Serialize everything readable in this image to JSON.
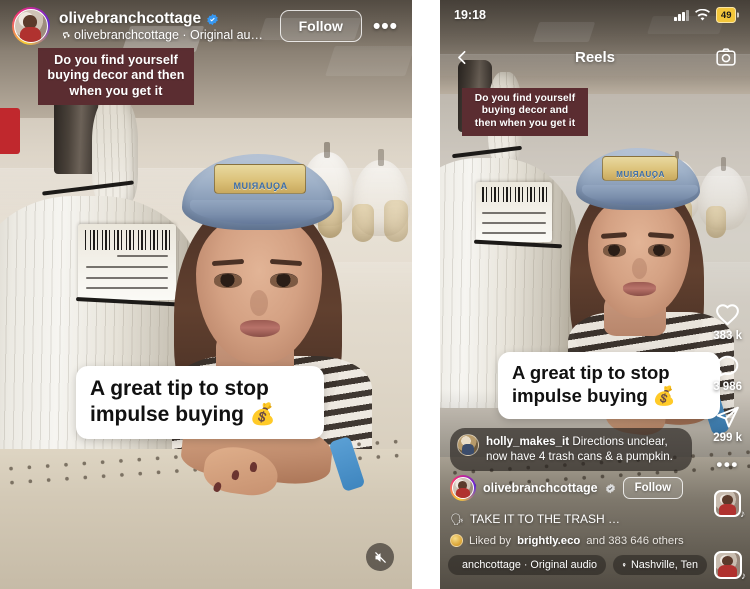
{
  "left_panel": {
    "header": {
      "username": "olivebranchcottage",
      "verified_icon": "verified-badge-icon",
      "music_icon": "music-note-icon",
      "audio_line": "olivebranchcottage · Original au…",
      "follow_label": "Follow",
      "more_label": "•••"
    },
    "caption_sticker": "Do you find yourself buying decor and then when you get it",
    "headline_sticker": "A great tip to stop impulse buying 💰",
    "mute_icon": "mute-speaker-icon",
    "cap_patch_text": "AQUARIUM"
  },
  "right_panel": {
    "status_bar": {
      "time": "19:18",
      "signal_icon": "cellular-signal-icon",
      "wifi_icon": "wifi-icon",
      "battery_level": "49",
      "battery_color": "#f3c63a"
    },
    "nav": {
      "back_icon": "back-chevron-icon",
      "title": "Reels",
      "camera_icon": "camera-icon"
    },
    "caption_sticker": "Do you find yourself buying decor and then when you get it",
    "headline_sticker": "A great tip to stop impulse buying 💰",
    "cap_patch_text": "AQUARIUM",
    "action_rail": [
      {
        "icon": "heart-icon",
        "name": "like-button",
        "count": "383 k"
      },
      {
        "icon": "comment-icon",
        "name": "comment-button",
        "count": "3 986"
      },
      {
        "icon": "share-icon",
        "name": "share-button",
        "count": "299 k"
      }
    ],
    "rail_more_label": "•••",
    "audio_thumb_icon": "audio-cover-thumbnail",
    "pinned_comment": {
      "username": "holly_makes_it",
      "text": "Directions unclear, now have 4 trash cans & a pumpkin."
    },
    "author_row": {
      "username": "olivebranchcottage",
      "verified_icon": "verified-badge-icon",
      "follow_label": "Follow"
    },
    "caption": {
      "emoji": "🗣",
      "text": "TAKE IT TO THE TRASH …"
    },
    "liked_by": {
      "prefix": "Liked by",
      "account": "brightly.eco",
      "suffix": "and 383 646 others"
    },
    "bottom_bar": {
      "music_icon": "music-note-icon",
      "music_text": "anchcottage · Original audio",
      "location_icon": "location-pin-icon",
      "location_text": "Nashville, Ten",
      "audio_thumb_icon": "audio-cover-thumbnail"
    }
  }
}
